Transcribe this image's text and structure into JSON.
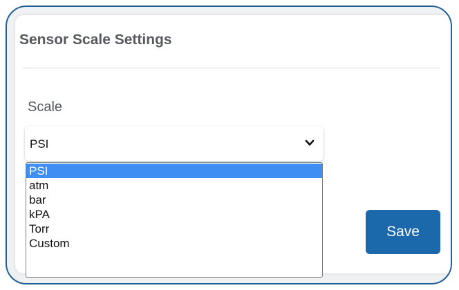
{
  "card": {
    "title": "Sensor Scale Settings"
  },
  "scale_field": {
    "label": "Scale",
    "selected_value": "PSI",
    "options": [
      "PSI",
      "atm",
      "bar",
      "kPA",
      "Torr",
      "Custom"
    ]
  },
  "actions": {
    "save_label": "Save"
  },
  "colors": {
    "frame_border": "#1f5f96",
    "primary_button": "#1b69aa",
    "option_highlight": "#3e8ef4"
  },
  "icons": {
    "select_arrow": "chevron-down-icon"
  }
}
